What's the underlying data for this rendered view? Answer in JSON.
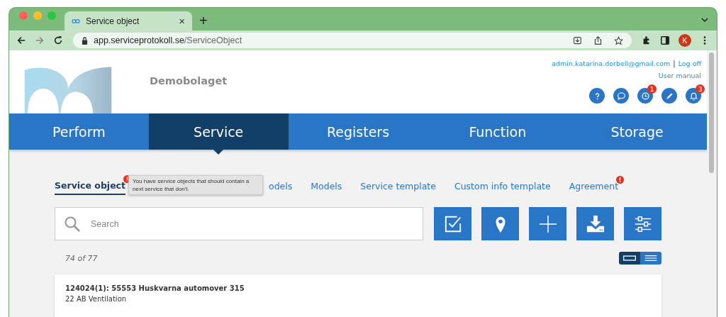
{
  "browser": {
    "tab_title": "Service object",
    "tab_close": "×",
    "new_tab": "+",
    "url_host": "app.serviceprotokoll.se",
    "url_path": "/ServiceObject",
    "profile_initial": "K"
  },
  "header": {
    "company": "Demobolaget",
    "user_email": "admin.katarina.dorbell@gmail.com",
    "separator": "|",
    "logoff": "Log off",
    "user_manual": "User manual",
    "icons": [
      {
        "kind": "help"
      },
      {
        "kind": "chat"
      },
      {
        "kind": "clock",
        "badge": "1"
      },
      {
        "kind": "pen"
      },
      {
        "kind": "bell",
        "badge": "3"
      }
    ]
  },
  "nav": [
    {
      "label": "Perform",
      "selected": false
    },
    {
      "label": "Service",
      "selected": true
    },
    {
      "label": "Registers",
      "selected": false
    },
    {
      "label": "Function",
      "selected": false
    },
    {
      "label": "Storage",
      "selected": false
    }
  ],
  "subtabs": [
    {
      "label": "Service object",
      "selected": true,
      "alert": true
    },
    {
      "label": "odels",
      "selected": false,
      "alert": false
    },
    {
      "label": "Models",
      "selected": false,
      "alert": false
    },
    {
      "label": "Service template",
      "selected": false,
      "alert": false
    },
    {
      "label": "Custom info template",
      "selected": false,
      "alert": false
    },
    {
      "label": "Agreement",
      "selected": false,
      "alert": true
    }
  ],
  "tooltip": "You have service objects that should contain a next service that don't.",
  "search": {
    "placeholder": "Search"
  },
  "actions": [
    {
      "kind": "check"
    },
    {
      "kind": "pin"
    },
    {
      "kind": "plus"
    },
    {
      "kind": "download"
    },
    {
      "kind": "sliders"
    }
  ],
  "count": "74 of 77",
  "view_toggle": [
    {
      "kind": "card",
      "selected": true
    },
    {
      "kind": "list",
      "selected": false
    }
  ],
  "items": [
    {
      "title": "124024(1): 55553 Huskvarna automover 315",
      "subtitle": "22 AB Ventilation"
    }
  ]
}
